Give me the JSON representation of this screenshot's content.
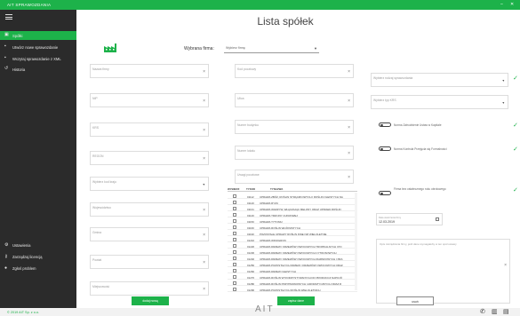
{
  "window": {
    "title": "AIT SPRAWOZDANIA",
    "minimize": "–",
    "close": "✕"
  },
  "sidebar": {
    "items": [
      {
        "label": "Spółki",
        "active": true,
        "icon": "building-icon"
      },
      {
        "label": "Utwórz nowe sprawozdanie",
        "active": false,
        "icon": "plus-icon"
      },
      {
        "label": "Wczytaj sprawozdanie z XML",
        "active": false,
        "icon": "upload-icon"
      },
      {
        "label": "Historia",
        "active": false,
        "icon": "history-icon"
      }
    ],
    "bottom": [
      {
        "label": "Ustawienia",
        "icon": "gear-icon"
      },
      {
        "label": "Zarządzaj licencją",
        "icon": "key-icon"
      },
      {
        "label": "Zgłoś problem",
        "icon": "bulb-icon"
      }
    ]
  },
  "main": {
    "heading": "Lista spółek",
    "firm_label": "Wybrana firma:",
    "firm_value": "Wybierz firmę",
    "col1": [
      "Nazwa firmy",
      "NIP",
      "KRS",
      "REGON",
      "Wybierz kod kraju",
      "Województwo",
      "Gmina",
      "Powiat",
      "Miejscowość"
    ],
    "col2": [
      "Kod pocztowy",
      "Ulica",
      "Numer budynku",
      "Numer lokalu",
      "Uwagi pocztowe"
    ],
    "col3": [
      "Wybierz rodzaj sprawozdania",
      "Wybierz typ KRS"
    ],
    "toggles": [
      "Norma Zatrudnienie Ustaw w Kapitale",
      "Norma Kontrola Przejęcia się Formalności",
      "Firma bez ostatecznego roku obrotowego"
    ],
    "date_label": "Data utworzenia firmy",
    "date_value": "12.03.2019",
    "textarea_placeholder": "Opis zarządzania firmy, jeśli dane wymagałoby w ten spół ustawy",
    "table": {
      "headers": [
        "WYBIERZ",
        "TYKOD",
        "TYNAZWA"
      ],
      "rows": [
        [
          "01112",
          "UPRAWA ZBÓŻ, ROŚLIN STRĄCZKOWYCH I ROŚLIN OLEISTYCH NA"
        ],
        [
          "01120",
          "UPRAWA RYŻU"
        ],
        [
          "01131",
          "UPRAWA WARZYW, WŁĄCZAJĄC MELONY ORAZ UPRAWA ROŚLIN"
        ],
        [
          "01140",
          "UPRAWA TRZCINY CUKROWEJ"
        ],
        [
          "01150",
          "UPRAWA TYTONIU"
        ],
        [
          "01160",
          "UPRAWA ROŚLIN WŁÓKNISTYCH"
        ],
        [
          "01190",
          "POZOSTAŁE UPRAWY ROŚLIN INNE NIŻ WIELOLETNIE"
        ],
        [
          "01210",
          "UPRAWA WINOGRON"
        ],
        [
          "01220",
          "UPRAWA DRZEW I KRZEWÓW OWOCOWYCH TROPIKALNYCH I PO"
        ],
        [
          "01230",
          "UPRAWA DRZEW I KRZEWÓW OWOCOWYCH CYTRUSOWYCH"
        ],
        [
          "01240",
          "UPRAWA DRZEW I KRZEWÓW OWOCOWYCH ZIARNKOWYCH I PES"
        ],
        [
          "01250",
          "UPRAWA POZOSTAŁYCH DRZEW I KRZEWÓW OWOCOWYCH ORAZ"
        ],
        [
          "01260",
          "UPRAWA DRZEW OLEISTYCH"
        ],
        [
          "01270",
          "UPRAWA ROŚLIN WYKORZYSTYWANYCH DO PRODUKCJI NAPOJÓ"
        ],
        [
          "01280",
          "UPRAWA ROŚLIN PRZYPRAWOWYCH I AROMATYCZNYCH ORAZ R"
        ],
        [
          "01290",
          "UPRAWA POZOSTAŁYCH ROŚLIN WIELOLETNICH"
        ]
      ]
    },
    "buttons": {
      "new_firm": "dodaj nową",
      "save": "zapisz dane",
      "delete": "usuń"
    }
  },
  "footer": {
    "copyright": "© 2019 AIT Sp. z o.o.",
    "brand": "AIT"
  },
  "colors": {
    "accent": "#1db24a",
    "sidebar": "#2b2b2b"
  }
}
